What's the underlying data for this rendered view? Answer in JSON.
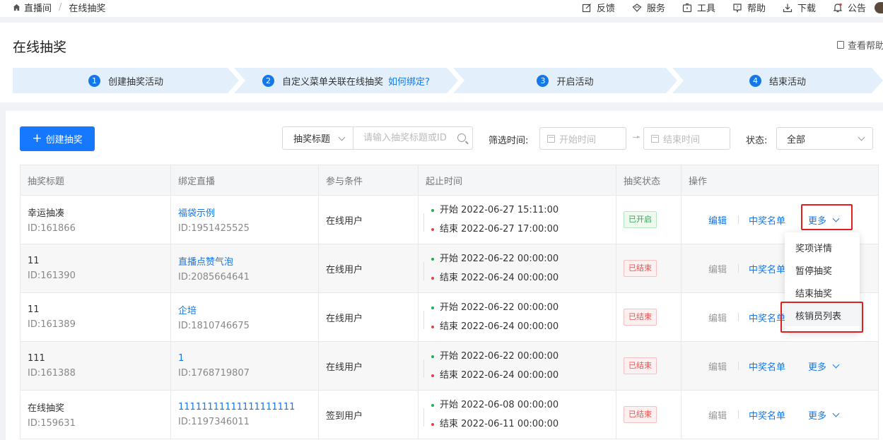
{
  "breadcrumb": {
    "home": "直播间",
    "current": "在线抽奖"
  },
  "topnav": [
    "反馈",
    "服务",
    "工具",
    "帮助",
    "下载",
    "公告"
  ],
  "header": {
    "title": "在线抽奖",
    "help": "查看帮助"
  },
  "steps": [
    {
      "num": "1",
      "label": "创建抽奖活动"
    },
    {
      "num": "2",
      "label": "自定义菜单关联在线抽奖",
      "link": "如何绑定?"
    },
    {
      "num": "3",
      "label": "开启活动"
    },
    {
      "num": "4",
      "label": "结束活动"
    }
  ],
  "toolbar": {
    "create": "创建抽奖",
    "search_field": "抽奖标题",
    "search_placeholder": "请输入抽奖标题或ID",
    "filter_time_label": "筛选时间:",
    "start_placeholder": "开始时间",
    "end_placeholder": "结束时间",
    "status_label": "状态:",
    "status_value": "全部"
  },
  "table": {
    "headers": [
      "抽奖标题",
      "绑定直播",
      "参与条件",
      "起止时间",
      "抽奖状态",
      "操作"
    ],
    "rows": [
      {
        "title": "幸运抽凑",
        "id": "ID:161866",
        "live": "福袋示例",
        "live_id": "ID:1951425525",
        "cond": "在线用户",
        "start": "开始 2022-06-27 15:11:00",
        "end": "结束 2022-06-27 17:00:00",
        "status": "已开启"
      },
      {
        "title": "11",
        "id": "ID:161390",
        "live": "直播点赞气泡",
        "live_id": "ID:2085664641",
        "cond": "在线用户",
        "start": "开始 2022-06-22 00:00:00",
        "end": "结束 2022-06-24 00:00:00",
        "status": "已结束"
      },
      {
        "title": "11",
        "id": "ID:161389",
        "live": "企培",
        "live_id": "ID:1810746675",
        "cond": "在线用户",
        "start": "开始 2022-06-22 00:00:00",
        "end": "结束 2022-06-24 00:00:00",
        "status": "已结束"
      },
      {
        "title": "111",
        "id": "ID:161388",
        "live": "1",
        "live_id": "ID:1768719807",
        "cond": "在线用户",
        "start": "开始 2022-06-22 00:00:00",
        "end": "结束 2022-06-24 00:00:00",
        "status": "已结束"
      },
      {
        "title": "在线抽奖",
        "id": "ID:159631",
        "live": "11111111111111111111",
        "live_id": "ID:1197346011",
        "cond": "签到用户",
        "start": "开始 2022-06-08 00:00:00",
        "end": "结束 2022-06-11 00:00:00",
        "status": "已结束"
      }
    ],
    "ops": {
      "edit": "编辑",
      "winners": "中奖名单",
      "more": "更多"
    }
  },
  "dropdown": [
    "奖项详情",
    "暂停抽奖",
    "结束抽奖",
    "核销员列表"
  ],
  "colors": {
    "primary": "#1677ff",
    "highlight": "#e02020"
  }
}
